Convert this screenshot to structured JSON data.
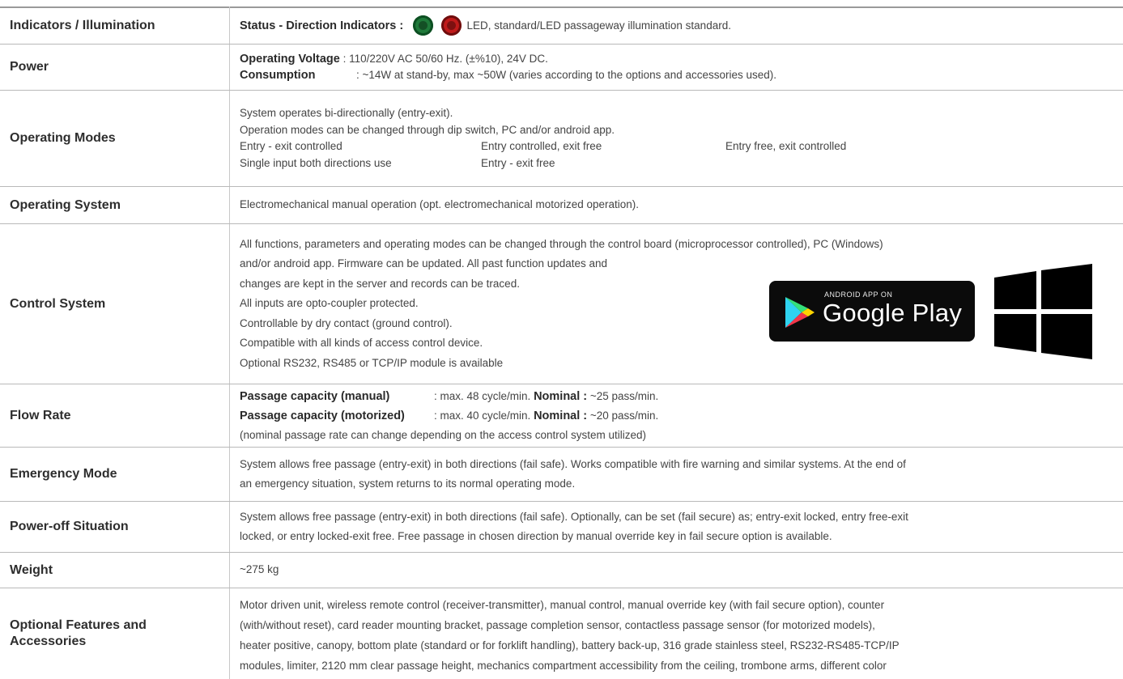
{
  "rows": {
    "indicators": {
      "label": "Indicators / Illumination",
      "status_key": "Status - Direction  Indicators :",
      "text": "LED, standard/LED passageway illumination standard."
    },
    "power": {
      "label": "Power",
      "voltage_key": "Operating Voltage",
      "voltage_val": ": 110/220V AC 50/60 Hz. (±%10), 24V DC.",
      "consumption_key": "Consumption",
      "consumption_val": ": ~14W at stand-by, max ~50W (varies according to the options and accessories used)."
    },
    "modes": {
      "label": "Operating Modes",
      "line1": "System operates bi-directionally (entry-exit).",
      "line2": "Operation modes can be changed through dip switch, PC and/or android app.",
      "m1": "Entry - exit controlled",
      "m2": "Entry controlled, exit free",
      "m3": "Entry free, exit controlled",
      "m4": "Single input both directions use",
      "m5": "Entry - exit free"
    },
    "opsystem": {
      "label": "Operating System",
      "text": "Electromechanical manual operation (opt. electromechanical motorized operation)."
    },
    "control": {
      "label": "Control System",
      "lines": [
        "All functions, parameters and operating modes can be changed through the control board (microprocessor controlled), PC (Windows)",
        "and/or android app. Firmware can be updated. All past function updates and",
        "changes are kept in the server and records can be traced.",
        "All inputs are opto-coupler protected.",
        "Controllable by dry contact (ground control).",
        "Compatible with all kinds of access control device.",
        "Optional RS232, RS485 or TCP/IP module is available"
      ],
      "badge_small": "ANDROID APP ON",
      "badge_big": "Google Play"
    },
    "flow": {
      "label": "Flow Rate",
      "manual_key": "Passage capacity (manual)",
      "manual_val": ": max. 48 cycle/min.",
      "motor_key": "Passage capacity (motorized)",
      "motor_val": ": max. 40 cycle/min.",
      "nominal_key": "Nominal :",
      "nominal_manual": "~25 pass/min.",
      "nominal_motor": "~20 pass/min.",
      "note": "(nominal passage rate can change depending on the access control system utilized)"
    },
    "emergency": {
      "label": "Emergency Mode",
      "line1": "System allows free passage (entry-exit) in both directions (fail safe). Works compatible with fire warning and similar systems. At the end of",
      "line2": "an emergency situation, system returns to its normal operating mode."
    },
    "poweroff": {
      "label": "Power-off Situation",
      "line1": "System allows free passage (entry-exit) in both directions (fail safe). Optionally, can be set (fail secure) as; entry-exit locked, entry free-exit",
      "line2": "locked, or entry locked-exit free. Free passage in chosen direction by manual override key in fail secure option is available."
    },
    "weight": {
      "label": "Weight",
      "text": "~275 kg"
    },
    "optional": {
      "label": "Optional Features and Accessories",
      "lines": [
        "Motor driven unit, wireless remote control (receiver-transmitter), manual control, manual override key (with fail secure option), counter",
        "(with/without reset), card reader mounting bracket, passage completion sensor, contactless passage sensor (for motorized models),",
        "heater positive, canopy, bottom plate (standard or for forklift handling), battery back-up, 316 grade stainless steel, RS232-RS485-TCP/IP",
        "modules, limiter, 2120 mm clear passage height, mechanics compartment accessibility from the ceiling, trombone arms, different color"
      ]
    }
  },
  "icons": {
    "green_indicator": "green-led-icon",
    "red_indicator": "red-led-icon",
    "google_play": "google-play-icon",
    "windows": "windows-logo-icon"
  },
  "colors": {
    "green_led": "#1f7a3a",
    "red_led": "#c01a1a"
  }
}
